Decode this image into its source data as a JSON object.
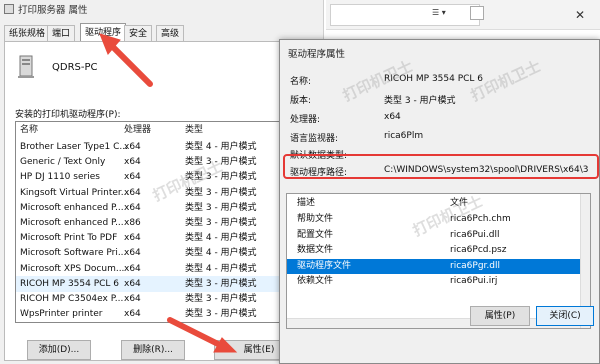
{
  "left_dialog": {
    "title": "打印服务器 属性",
    "tabs": [
      "纸张规格",
      "端口",
      "驱动程序",
      "安全",
      "高级"
    ],
    "active_tab": "驱动程序",
    "server_name": "QDRS-PC",
    "list_label": "安装的打印机驱动程序(P):",
    "columns": [
      "名称",
      "处理器",
      "类型"
    ],
    "rows": [
      [
        "Brother Laser Type1 C...",
        "x64",
        "类型 4 - 用户模式"
      ],
      [
        "Generic / Text Only",
        "x64",
        "类型 3 - 用户模式"
      ],
      [
        "HP DJ 1110 series",
        "x64",
        "类型 3 - 用户模式"
      ],
      [
        "Kingsoft Virtual Printer...",
        "x64",
        "类型 3 - 用户模式"
      ],
      [
        "Microsoft enhanced P...",
        "x64",
        "类型 3 - 用户模式"
      ],
      [
        "Microsoft enhanced P...",
        "x86",
        "类型 3 - 用户模式"
      ],
      [
        "Microsoft Print To PDF",
        "x64",
        "类型 4 - 用户模式"
      ],
      [
        "Microsoft Software Pri...",
        "x64",
        "类型 4 - 用户模式"
      ],
      [
        "Microsoft XPS Docum...",
        "x64",
        "类型 4 - 用户模式"
      ],
      [
        "RICOH MP 3554 PCL 6",
        "x64",
        "类型 3 - 用户模式"
      ],
      [
        "RICOH MP C3504ex P...",
        "x64",
        "类型 3 - 用户模式"
      ],
      [
        "WpsPrinter printer",
        "x64",
        "类型 3 - 用户模式"
      ]
    ],
    "buttons": {
      "add": "添加(D)...",
      "remove": "删除(R)...",
      "properties": "属性(E)"
    }
  },
  "right_dialog": {
    "title": "驱动程序属性",
    "fields": [
      {
        "k": "名称:",
        "v": "RICOH MP 3554 PCL 6"
      },
      {
        "k": "版本:",
        "v": "类型 3 - 用户模式"
      },
      {
        "k": "处理器:",
        "v": "x64"
      },
      {
        "k": "语言监视器:",
        "v": "rica6Plm"
      },
      {
        "k": "默认数据类型:",
        "v": ""
      },
      {
        "k": "驱动程序路径:",
        "v": "C:\\WINDOWS\\system32\\spool\\DRIVERS\\x64\\3"
      }
    ],
    "file_columns": [
      "描述",
      "文件"
    ],
    "files": [
      [
        "帮助文件",
        "rica6Pch.chm"
      ],
      [
        "配置文件",
        "rica6Pui.dll"
      ],
      [
        "数据文件",
        "rica6Pcd.psz"
      ],
      [
        "驱动程序文件",
        "rica6Pgr.dll"
      ],
      [
        "依赖文件",
        "rica6Pui.irj"
      ]
    ],
    "buttons": {
      "properties": "属性(P)",
      "close": "关闭(C)"
    }
  },
  "watermark": "打印机卫士",
  "colors": {
    "highlight_box": "#e53935",
    "arrow": "#e94b3c",
    "selection": "#0078d7"
  }
}
